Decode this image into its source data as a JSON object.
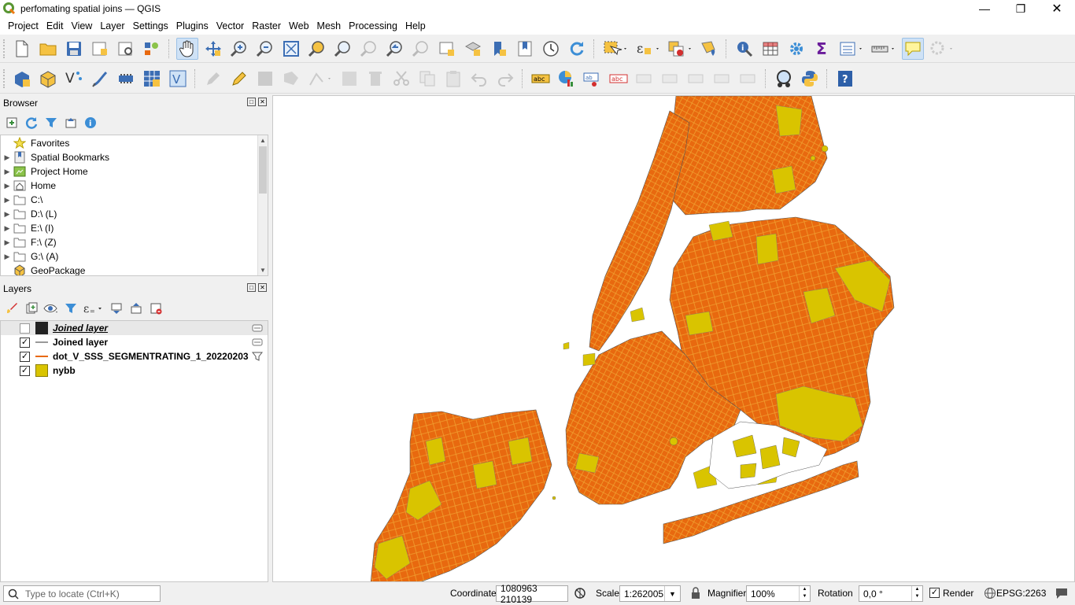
{
  "window": {
    "title": "perfomating spatial joins — QGIS"
  },
  "menu": [
    "Project",
    "Edit",
    "View",
    "Layer",
    "Settings",
    "Plugins",
    "Vector",
    "Raster",
    "Web",
    "Mesh",
    "Processing",
    "Help"
  ],
  "browser": {
    "title": "Browser",
    "items": [
      {
        "label": "Favorites",
        "icon": "star-icon"
      },
      {
        "label": "Spatial Bookmarks",
        "icon": "bookmark-icon"
      },
      {
        "label": "Project Home",
        "icon": "project-home-icon"
      },
      {
        "label": "Home",
        "icon": "home-icon"
      },
      {
        "label": "C:\\",
        "icon": "folder-icon"
      },
      {
        "label": "D:\\ (L)",
        "icon": "folder-icon"
      },
      {
        "label": "E:\\ (I)",
        "icon": "folder-icon"
      },
      {
        "label": "F:\\ (Z)",
        "icon": "folder-icon"
      },
      {
        "label": "G:\\ (A)",
        "icon": "folder-icon"
      },
      {
        "label": "GeoPackage",
        "icon": "geopackage-icon"
      }
    ]
  },
  "layers": {
    "title": "Layers",
    "items": [
      {
        "label": "Joined layer",
        "checked": false,
        "symbol": "black-square",
        "style": "italic-bold-underline"
      },
      {
        "label": "Joined layer",
        "checked": true,
        "symbol": "gray-line"
      },
      {
        "label": "dot_V_SSS_SEGMENTRATING_1_20220203",
        "checked": true,
        "symbol": "orange-line"
      },
      {
        "label": "nybb",
        "checked": true,
        "symbol": "yellow-square"
      }
    ]
  },
  "colors": {
    "polygon_fill": "#d9c400",
    "line": "#e8690f",
    "active_tool": "#cfe2f6"
  },
  "status": {
    "locator_placeholder": "Type to locate (Ctrl+K)",
    "coordinate_label": "Coordinate",
    "coordinate_value": "1080963 210139",
    "scale_label": "Scale",
    "scale_value": "1:262005",
    "magnifier_label": "Magnifier",
    "magnifier_value": "100%",
    "rotation_label": "Rotation",
    "rotation_value": "0,0 °",
    "render_label": "Render",
    "render_checked": true,
    "crs": "EPSG:2263"
  }
}
